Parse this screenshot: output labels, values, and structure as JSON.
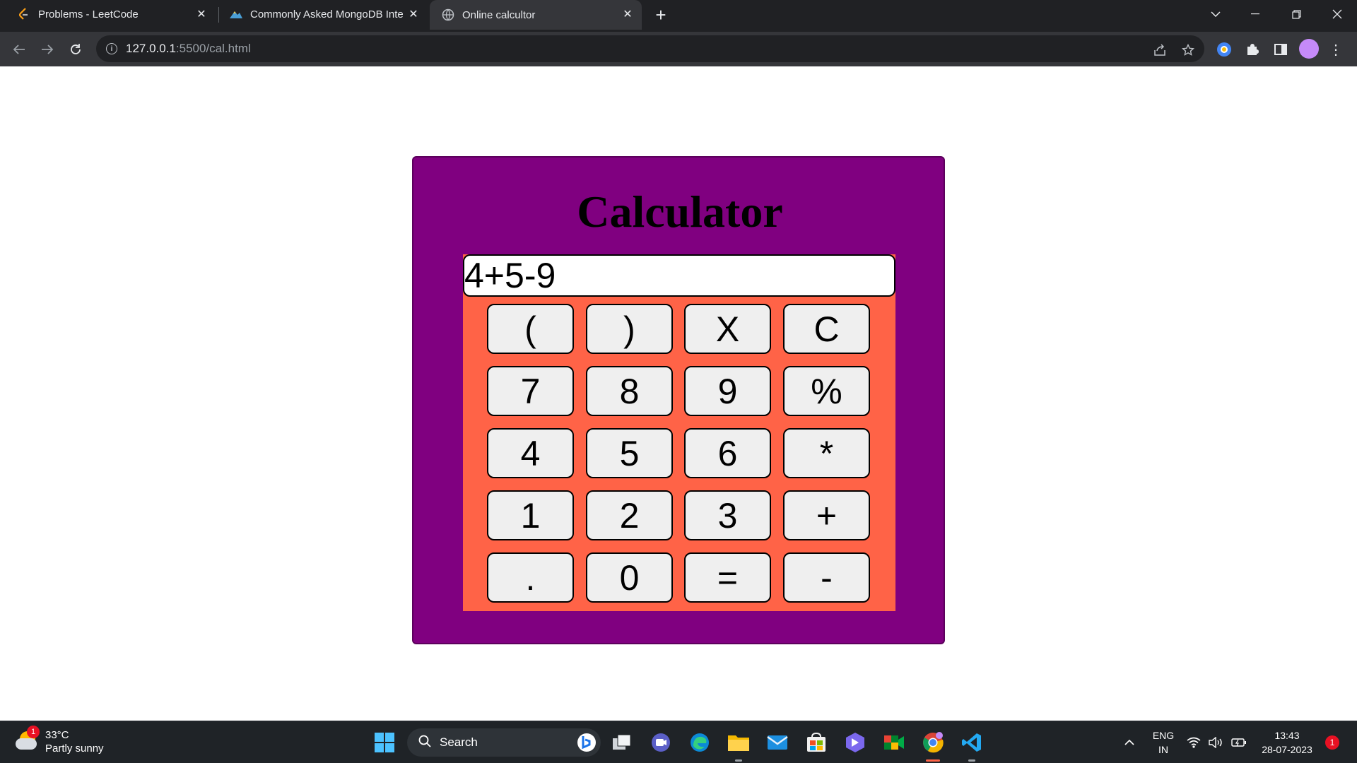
{
  "browser": {
    "tabs": [
      {
        "title": "Problems - LeetCode",
        "icon": "leetcode-icon"
      },
      {
        "title": "Commonly Asked MongoDB Inte",
        "icon": "mountain-icon"
      },
      {
        "title": "Online calcultor",
        "icon": "globe-icon",
        "active": true
      }
    ],
    "url_host": "127.0.0.1",
    "url_path": ":5500/cal.html"
  },
  "page": {
    "title": "Calculator",
    "display_value": "4+5-9",
    "keys": [
      [
        "(",
        ")",
        "X",
        "C"
      ],
      [
        "7",
        "8",
        "9",
        "%"
      ],
      [
        "4",
        "5",
        "6",
        "*"
      ],
      [
        "1",
        "2",
        "3",
        "+"
      ],
      [
        ".",
        "0",
        "=",
        "-"
      ]
    ],
    "colors": {
      "panel": "#800080",
      "body": "#ff6347",
      "key": "#efefef"
    }
  },
  "taskbar": {
    "weather_temp": "33°C",
    "weather_desc": "Partly sunny",
    "weather_badge": "1",
    "search_label": "Search",
    "lang_top": "ENG",
    "lang_bottom": "IN",
    "time": "13:43",
    "date": "28-07-2023",
    "notification_count": "1"
  }
}
